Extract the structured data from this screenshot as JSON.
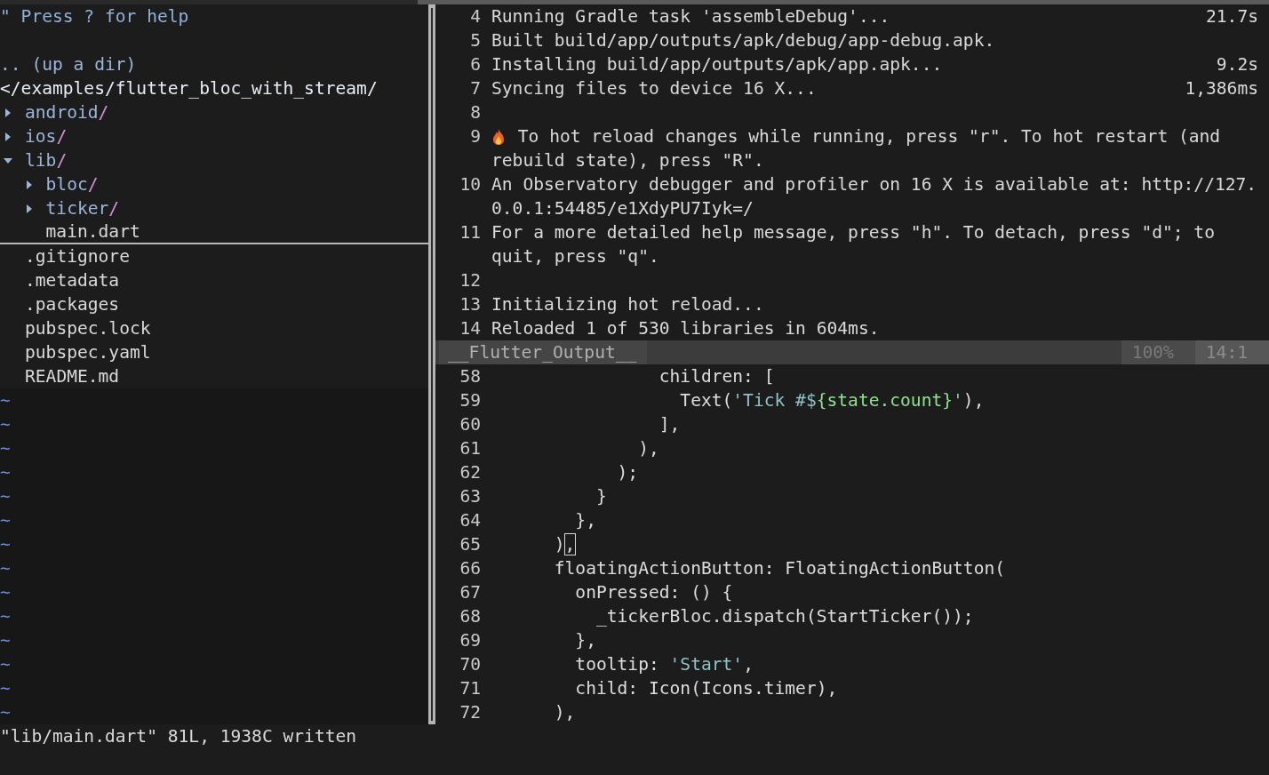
{
  "explorer": {
    "help": "\" Press ? for help",
    "up_dir": ".. (up a dir)",
    "root": "</examples/flutter_bloc_with_stream/",
    "entries": [
      {
        "name": "android",
        "slash": "/",
        "kind": "dir",
        "expanded": false,
        "selected": false
      },
      {
        "name": "ios",
        "slash": "/",
        "kind": "dir",
        "expanded": false,
        "selected": false
      },
      {
        "name": "lib",
        "slash": "/",
        "kind": "dir",
        "expanded": true,
        "selected": false,
        "children": [
          {
            "name": "bloc",
            "slash": "/",
            "kind": "dir",
            "expanded": false,
            "selected": false
          },
          {
            "name": "ticker",
            "slash": "/",
            "kind": "dir",
            "expanded": false,
            "selected": false
          },
          {
            "name": "main.dart",
            "kind": "file",
            "selected": true
          }
        ]
      },
      {
        "name": ".gitignore",
        "kind": "file",
        "selected": false
      },
      {
        "name": ".metadata",
        "kind": "file",
        "selected": false
      },
      {
        "name": ".packages",
        "kind": "file",
        "selected": false
      },
      {
        "name": "pubspec.lock",
        "kind": "file",
        "selected": false
      },
      {
        "name": "pubspec.yaml",
        "kind": "file",
        "selected": false
      },
      {
        "name": "README.md",
        "kind": "file",
        "selected": false
      }
    ],
    "end_of_buffer": [
      "~",
      "~",
      "~",
      "~",
      "~",
      "~",
      "~",
      "~",
      "~",
      "~",
      "~",
      "~",
      "~",
      "~"
    ]
  },
  "output": {
    "lines": [
      {
        "number": "4",
        "text": "Running Gradle task 'assembleDebug'...",
        "time": "21.7s",
        "icon": false
      },
      {
        "number": "5",
        "text": "Built build/app/outputs/apk/debug/app-debug.apk.",
        "icon": false
      },
      {
        "number": "6",
        "text": "Installing build/app/outputs/apk/app.apk...",
        "time": "9.2s",
        "icon": false
      },
      {
        "number": "7",
        "text": "Syncing files to device 16 X...",
        "time": "1,386ms",
        "icon": false
      },
      {
        "number": "8",
        "icon": false
      },
      {
        "number": "9",
        "text": " To hot reload changes while running, press \"r\". To hot restart (and",
        "wrap": "rebuild state), press \"R\".",
        "icon": true
      },
      {
        "number": "10",
        "text": "An Observatory debugger and profiler on 16 X is available at: http://127.",
        "wrap": "0.0.1:54485/e1XdyPU7Iyk=/",
        "icon": false
      },
      {
        "number": "11",
        "text": "For a more detailed help message, press \"h\". To detach, press \"d\"; to",
        "wrap": "quit, press \"q\".",
        "icon": false
      },
      {
        "number": "12",
        "icon": false
      },
      {
        "number": "13",
        "text": "Initializing hot reload...",
        "icon": false
      },
      {
        "number": "14",
        "text": "Reloaded 1 of 530 libraries in 604ms.",
        "icon": false
      }
    ],
    "status": {
      "name": "__Flutter_Output__",
      "percent": "100%",
      "position": "14:1"
    }
  },
  "code": {
    "lines": [
      {
        "number": "58",
        "segments": [
          {
            "kind": "plain",
            "text": "                children: ["
          }
        ]
      },
      {
        "number": "59",
        "segments": [
          {
            "kind": "plain",
            "text": "                  Text("
          },
          {
            "kind": "string",
            "text": "'Tick #$"
          },
          {
            "kind": "interp",
            "text": "{state.count}"
          },
          {
            "kind": "string",
            "text": "'"
          },
          {
            "kind": "plain",
            "text": "),"
          }
        ]
      },
      {
        "number": "60",
        "segments": [
          {
            "kind": "plain",
            "text": "                ],"
          }
        ]
      },
      {
        "number": "61",
        "segments": [
          {
            "kind": "plain",
            "text": "              ),"
          }
        ]
      },
      {
        "number": "62",
        "segments": [
          {
            "kind": "plain",
            "text": "            );"
          }
        ]
      },
      {
        "number": "63",
        "segments": [
          {
            "kind": "plain",
            "text": "          }"
          }
        ]
      },
      {
        "number": "64",
        "segments": [
          {
            "kind": "plain",
            "text": "        },"
          }
        ]
      },
      {
        "number": "65",
        "segments": [
          {
            "kind": "plain",
            "text": "      )"
          },
          {
            "kind": "cursor",
            "text": ","
          }
        ]
      },
      {
        "number": "66",
        "segments": [
          {
            "kind": "plain",
            "text": "      floatingActionButton: FloatingActionButton("
          }
        ]
      },
      {
        "number": "67",
        "segments": [
          {
            "kind": "plain",
            "text": "        onPressed: () {"
          }
        ]
      },
      {
        "number": "68",
        "segments": [
          {
            "kind": "plain",
            "text": "          _tickerBloc.dispatch(StartTicker());"
          }
        ]
      },
      {
        "number": "69",
        "segments": [
          {
            "kind": "plain",
            "text": "        },"
          }
        ]
      },
      {
        "number": "70",
        "segments": [
          {
            "kind": "plain",
            "text": "        tooltip: "
          },
          {
            "kind": "string",
            "text": "'Start'"
          },
          {
            "kind": "plain",
            "text": ","
          }
        ]
      },
      {
        "number": "71",
        "segments": [
          {
            "kind": "plain",
            "text": "        child: Icon(Icons.timer),"
          }
        ]
      },
      {
        "number": "72",
        "segments": [
          {
            "kind": "plain",
            "text": "      ),"
          }
        ]
      }
    ]
  },
  "command_line": "\"lib/main.dart\" 81L, 1938C written"
}
